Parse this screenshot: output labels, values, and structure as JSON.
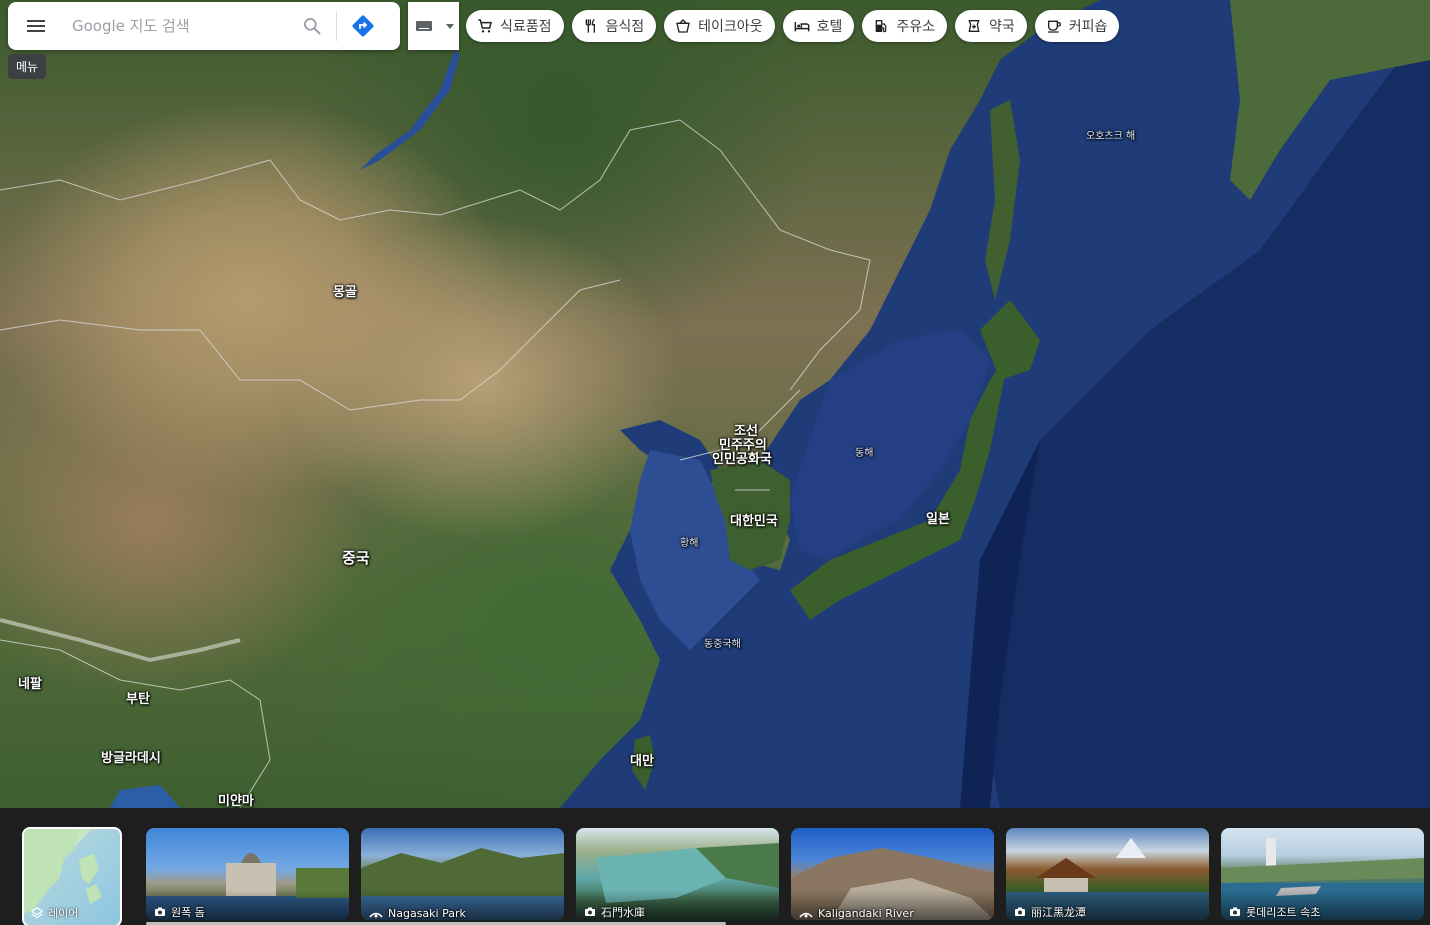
{
  "search": {
    "placeholder": "Google 지도 검색",
    "menu_tooltip": "메뉴",
    "menu_icon": "menu-icon",
    "search_icon": "search-icon",
    "directions_icon": "directions-icon",
    "directions_color": "#1a73e8"
  },
  "tools": {
    "keyboard_icon": "keyboard-icon",
    "dropdown_icon": "chevron-down-icon"
  },
  "chips": [
    {
      "label": "식료품점",
      "icon": "cart-icon"
    },
    {
      "label": "음식점",
      "icon": "restaurant-icon"
    },
    {
      "label": "테이크아웃",
      "icon": "takeout-icon"
    },
    {
      "label": "호텔",
      "icon": "hotel-icon"
    },
    {
      "label": "주유소",
      "icon": "gas-station-icon"
    },
    {
      "label": "약국",
      "icon": "pharmacy-icon"
    },
    {
      "label": "커피숍",
      "icon": "coffee-icon"
    }
  ],
  "map": {
    "view": "satellite",
    "labels": {
      "mongolia": "몽골",
      "china": "중국",
      "north_korea_1": "조선",
      "north_korea_2": "민주주의",
      "north_korea_3": "인민공화국",
      "south_korea": "대한민국",
      "japan": "일본",
      "east_sea": "동해",
      "yellow_sea": "황해",
      "east_china_sea": "동중국해",
      "okhotsk_sea": "오호츠크 해",
      "nepal": "네팔",
      "bhutan": "부탄",
      "bangladesh": "방글라데시",
      "myanmar": "미얀마",
      "taiwan": "대만"
    }
  },
  "layers": {
    "label": "레이어",
    "icon": "layers-icon"
  },
  "photos": [
    {
      "caption": "원폭 돔",
      "icon": "camera-icon"
    },
    {
      "caption": "Nagasaki Park",
      "icon": "panorama-icon"
    },
    {
      "caption": "石門水庫",
      "icon": "camera-icon"
    },
    {
      "caption": "Kaligandaki River",
      "icon": "panorama-icon"
    },
    {
      "caption": "丽江黑龙潭",
      "icon": "camera-icon"
    },
    {
      "caption": "롯데리조트 속초",
      "icon": "camera-icon"
    }
  ]
}
